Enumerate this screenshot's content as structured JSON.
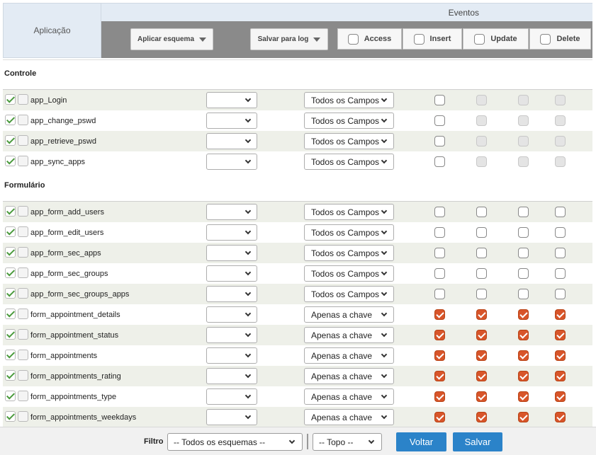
{
  "header": {
    "app_label": "Aplicação",
    "eventos_label": "Eventos",
    "apply_schema": "Aplicar esquema",
    "save_log": "Salvar para log",
    "events": [
      "Access",
      "Insert",
      "Update",
      "Delete"
    ]
  },
  "sections": [
    {
      "title": "Controle",
      "rows": [
        {
          "name": "app_Login",
          "fields": "Todos os Campos",
          "events": [
            "off",
            "disabled",
            "disabled",
            "disabled"
          ]
        },
        {
          "name": "app_change_pswd",
          "fields": "Todos os Campos",
          "events": [
            "off",
            "disabled",
            "disabled",
            "disabled"
          ]
        },
        {
          "name": "app_retrieve_pswd",
          "fields": "Todos os Campos",
          "events": [
            "off",
            "disabled",
            "disabled",
            "disabled"
          ]
        },
        {
          "name": "app_sync_apps",
          "fields": "Todos os Campos",
          "events": [
            "off",
            "disabled",
            "disabled",
            "disabled"
          ]
        }
      ]
    },
    {
      "title": "Formulário",
      "rows": [
        {
          "name": "app_form_add_users",
          "fields": "Todos os Campos",
          "events": [
            "off",
            "off",
            "off",
            "off"
          ]
        },
        {
          "name": "app_form_edit_users",
          "fields": "Todos os Campos",
          "events": [
            "off",
            "off",
            "off",
            "off"
          ]
        },
        {
          "name": "app_form_sec_apps",
          "fields": "Todos os Campos",
          "events": [
            "off",
            "off",
            "off",
            "off"
          ]
        },
        {
          "name": "app_form_sec_groups",
          "fields": "Todos os Campos",
          "events": [
            "off",
            "off",
            "off",
            "off"
          ]
        },
        {
          "name": "app_form_sec_groups_apps",
          "fields": "Todos os Campos",
          "events": [
            "off",
            "off",
            "off",
            "off"
          ]
        },
        {
          "name": "form_appointment_details",
          "fields": "Apenas a chave",
          "events": [
            "on",
            "on",
            "on",
            "on"
          ]
        },
        {
          "name": "form_appointment_status",
          "fields": "Apenas a chave",
          "events": [
            "on",
            "on",
            "on",
            "on"
          ]
        },
        {
          "name": "form_appointments",
          "fields": "Apenas a chave",
          "events": [
            "on",
            "on",
            "on",
            "on"
          ]
        },
        {
          "name": "form_appointments_rating",
          "fields": "Apenas a chave",
          "events": [
            "on",
            "on",
            "on",
            "on"
          ]
        },
        {
          "name": "form_appointments_type",
          "fields": "Apenas a chave",
          "events": [
            "on",
            "on",
            "on",
            "on"
          ]
        },
        {
          "name": "form_appointments_weekdays",
          "fields": "Apenas a chave",
          "events": [
            "on",
            "on",
            "on",
            "on"
          ]
        }
      ]
    }
  ],
  "footer": {
    "filter_label": "Filtro",
    "schema_select": "-- Todos os esquemas --",
    "position_select": "-- Topo --",
    "back_button": "Voltar",
    "save_button": "Salvar"
  },
  "colors": {
    "accent_button": "#2b83c9",
    "checked_event": "#d8552a",
    "row_stripe": "#eef0e9",
    "header_bar": "#8a8a8a"
  }
}
